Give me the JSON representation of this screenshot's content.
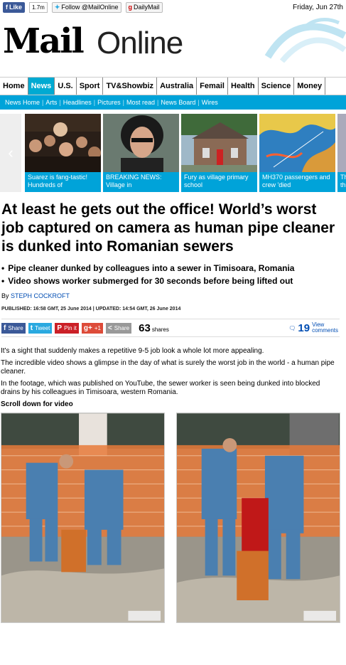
{
  "topbar": {
    "like_label": "Like",
    "like_count": "1.7m",
    "follow_label": "Follow @MailOnline",
    "dailymail_label": "DailyMail",
    "date": "Friday, Jun 27th"
  },
  "masthead": {
    "logo_primary": "Mail",
    "logo_secondary": "Online"
  },
  "nav": {
    "items": [
      "Home",
      "News",
      "U.S.",
      "Sport",
      "TV&Showbiz",
      "Australia",
      "Femail",
      "Health",
      "Science",
      "Money"
    ],
    "active": "News"
  },
  "subnav": {
    "items": [
      "News Home",
      "Arts",
      "Headlines",
      "Pictures",
      "Most read",
      "News Board",
      "Wires"
    ]
  },
  "carousel": {
    "prev_arrow": "‹",
    "slides": [
      {
        "caption": "Suarez is fang-tastic! Hundreds of"
      },
      {
        "caption": "BREAKING NEWS: Village in"
      },
      {
        "caption": "Fury as village primary school"
      },
      {
        "caption": "MH370 passengers and crew 'died"
      },
      {
        "caption": "Th th"
      }
    ]
  },
  "article": {
    "headline": "At least he gets out the office! World’s worst job captured on camera as human pipe cleaner is dunked into Romanian sewers",
    "bullets": [
      "Pipe cleaner dunked by colleagues into a sewer in Timisoara, Romania",
      "Video shows worker submerged for 30 seconds before being lifted out"
    ],
    "byline_prefix": "By",
    "author": "STEPH COCKROFT",
    "published": "PUBLISHED: 16:58 GMT, 25 June 2014 | UPDATED: 14:54 GMT, 26 June 2014",
    "paragraphs": [
      "It's a sight that suddenly makes a repetitive 9-5 job look a whole lot more appealing.",
      "The incredible video shows a glimpse in the day of what is surely the worst job in the world - a human pipe cleaner.",
      "In the footage, which was published on YouTube, the sewer worker is seen being dunked into blocked drains by his colleagues in Timisoara, western Romania."
    ],
    "scroll_down": "Scroll down for video"
  },
  "share": {
    "facebook": "Share",
    "twitter": "Tweet",
    "pinterest": "Pin it",
    "gplus": "+1",
    "generic": "Share",
    "share_count": "63",
    "share_count_label": "shares",
    "comment_count": "19",
    "comment_label_1": "View",
    "comment_label_2": "comments"
  },
  "colors": {
    "accent": "#00a3d9",
    "link": "#004db3"
  }
}
